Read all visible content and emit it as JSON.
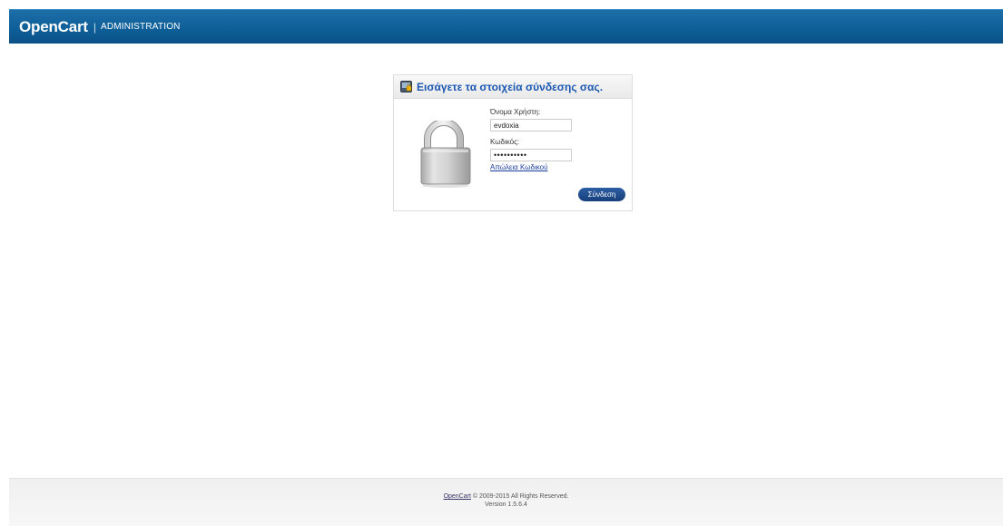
{
  "header": {
    "brand": "OpenCart",
    "separator": "|",
    "subtitle": "ADMINISTRATION"
  },
  "login": {
    "title": "Εισάγετε τα στοιχεία σύνδεσης σας.",
    "username_label": "Όνομα Χρήστη:",
    "username_value": "evdoxia",
    "password_label": "Κωδικός:",
    "password_value": "••••••••••",
    "forgot_link": "Απώλεια Κωδικού",
    "submit_label": "Σύνδεση"
  },
  "footer": {
    "link": "OpenCart",
    "copyright": "© 2009-2015 All Rights Reserved.",
    "version": "Version 1.5.6.4"
  },
  "colors": {
    "header_bg": "#0f5f99",
    "heading_text": "#1b57b1",
    "button_bg": "#1f4d8e"
  }
}
